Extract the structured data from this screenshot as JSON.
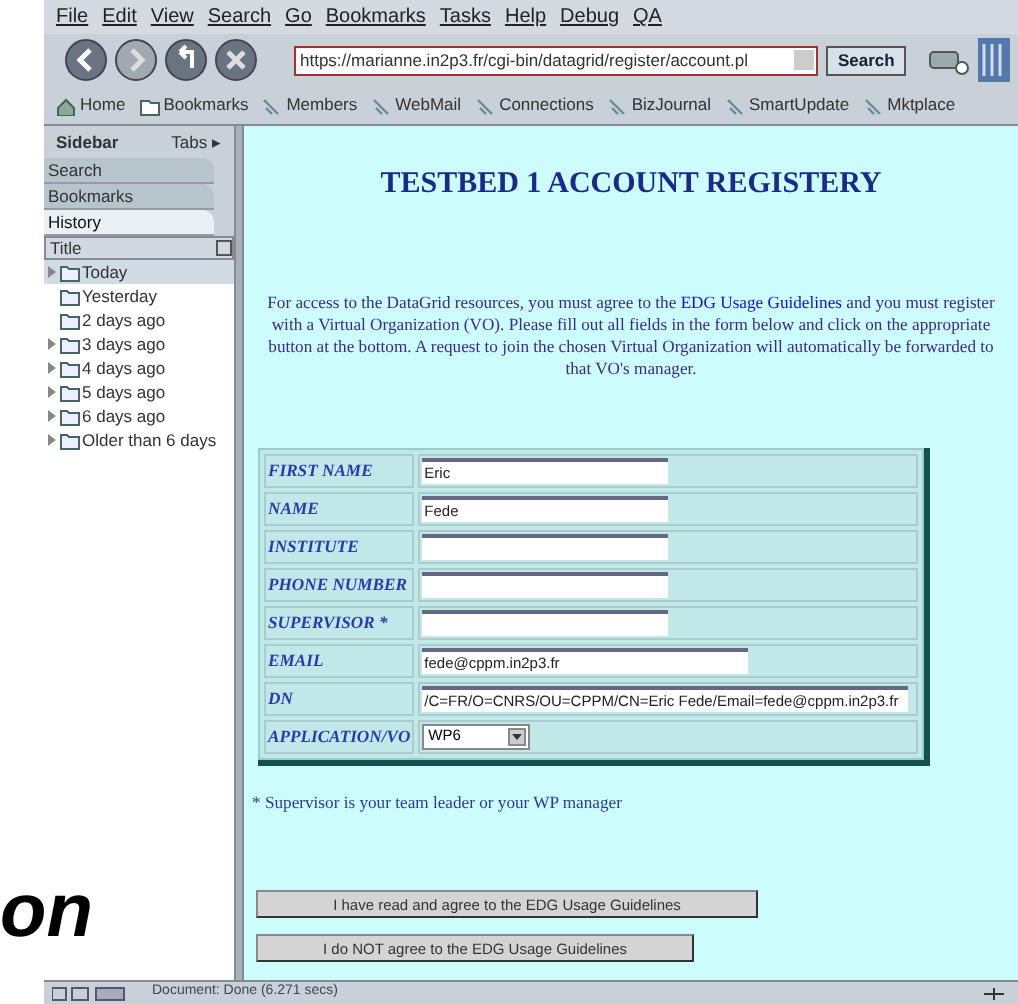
{
  "menu": [
    "File",
    "Edit",
    "View",
    "Search",
    "Go",
    "Bookmarks",
    "Tasks",
    "Help",
    "Debug",
    "QA"
  ],
  "address": {
    "value": "https://marianne.in2p3.fr/cgi-bin/datagrid/register/account.pl"
  },
  "search_button": "Search",
  "bookmarks": [
    {
      "label": "Home",
      "kind": "home"
    },
    {
      "label": "Bookmarks",
      "kind": "folder"
    },
    {
      "label": "Members",
      "kind": "link"
    },
    {
      "label": "WebMail",
      "kind": "link"
    },
    {
      "label": "Connections",
      "kind": "link"
    },
    {
      "label": "BizJournal",
      "kind": "link"
    },
    {
      "label": "SmartUpdate",
      "kind": "link"
    },
    {
      "label": "Mktplace",
      "kind": "link"
    }
  ],
  "sidebar": {
    "title": "Sidebar",
    "tabs_label": "Tabs ▸",
    "panels": [
      {
        "label": "Search",
        "selected": false
      },
      {
        "label": "Bookmarks",
        "selected": false
      },
      {
        "label": "History",
        "selected": true
      }
    ],
    "column": "Title",
    "items": [
      {
        "label": "Today",
        "selected": true,
        "has_children": true
      },
      {
        "label": "Yesterday",
        "selected": false,
        "has_children": false
      },
      {
        "label": "2 days ago",
        "selected": false,
        "has_children": false
      },
      {
        "label": "3 days ago",
        "selected": false,
        "has_children": true
      },
      {
        "label": "4 days ago",
        "selected": false,
        "has_children": true
      },
      {
        "label": "5 days ago",
        "selected": false,
        "has_children": true
      },
      {
        "label": "6 days ago",
        "selected": false,
        "has_children": true
      },
      {
        "label": "Older than 6 days",
        "selected": false,
        "has_children": true
      }
    ]
  },
  "page": {
    "title": "TESTBED 1 ACCOUNT REGISTERY",
    "intro_before": "For access to the DataGrid resources, you must agree to the ",
    "intro_link": "EDG Usage Guidelines",
    "intro_after": " and you must register with a Virtual Organization (VO). Please fill out all fields in the form below and click on the appropriate button at the bottom. A request to join the chosen Virtual Organization will automatically be forwarded to that VO's manager.",
    "fields": [
      {
        "label": "FIRST NAME",
        "value": "Eric",
        "kind": "short"
      },
      {
        "label": "NAME",
        "value": "Fede",
        "kind": "short"
      },
      {
        "label": "INSTITUTE",
        "kind": "short"
      },
      {
        "label": "PHONE NUMBER",
        "kind": "short"
      },
      {
        "label": "SUPERVISOR *",
        "kind": "short"
      },
      {
        "label": "EMAIL",
        "value": "fede@cppm.in2p3.fr",
        "kind": "medium"
      },
      {
        "label": "DN",
        "value": "/C=FR/O=CNRS/OU=CPPM/CN=Eric Fede/Email=fede@cppm.in2p3.fr",
        "kind": "long"
      },
      {
        "label": "APPLICATION/VO",
        "value": "WP6",
        "kind": "select"
      }
    ],
    "note": "* Supervisor is your team leader or your WP manager",
    "buttons": [
      "I have read and agree to the EDG Usage Guidelines",
      "I do NOT agree to the EDG Usage Guidelines"
    ]
  },
  "status": "Document: Done (6.271 secs)",
  "overlay_text": "on"
}
